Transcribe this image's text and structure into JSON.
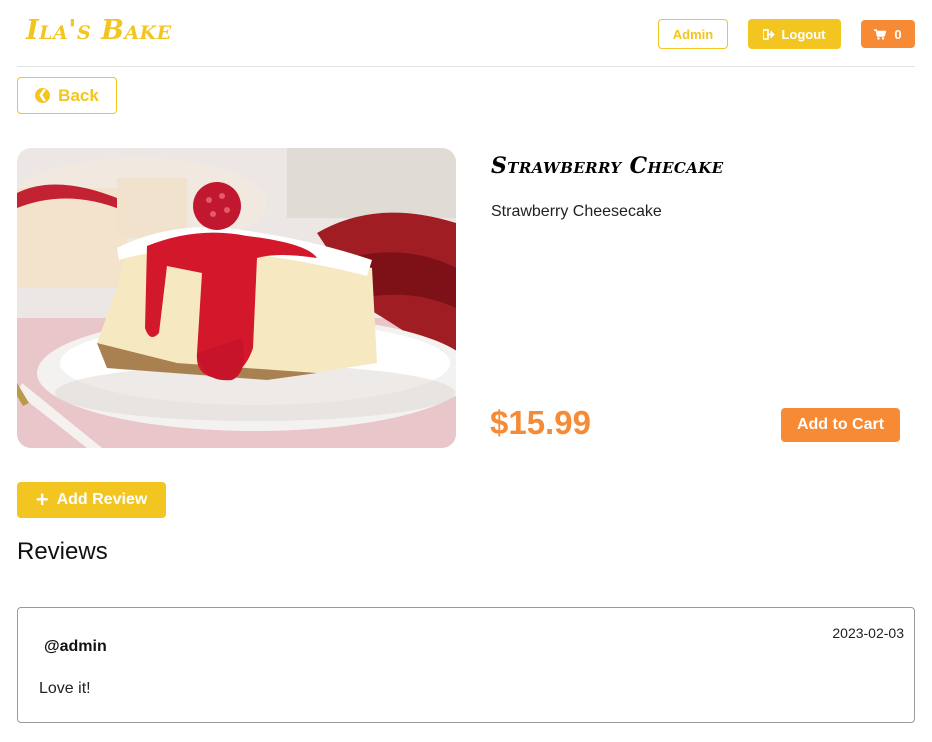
{
  "navbar": {
    "brand": "Ila's Bake",
    "admin_label": "Admin",
    "logout_label": "Logout",
    "cart_count": "0"
  },
  "back_label": "Back",
  "product": {
    "title": "Strawberry Checake",
    "description": "Strawberry Cheesecake",
    "price": "$15.99",
    "add_to_cart_label": "Add to Cart"
  },
  "add_review_label": "Add Review",
  "reviews_heading": "Reviews",
  "reviews": [
    {
      "user": "@admin",
      "date": "2023-02-03",
      "text": "Love it!"
    }
  ],
  "colors": {
    "brand_yellow": "#f2c521",
    "accent_orange": "#f68a35",
    "divider": "#e2e2e2"
  },
  "icons": [
    "sign-out-icon",
    "cart-icon",
    "arrow-circle-left-icon",
    "plus-icon"
  ]
}
